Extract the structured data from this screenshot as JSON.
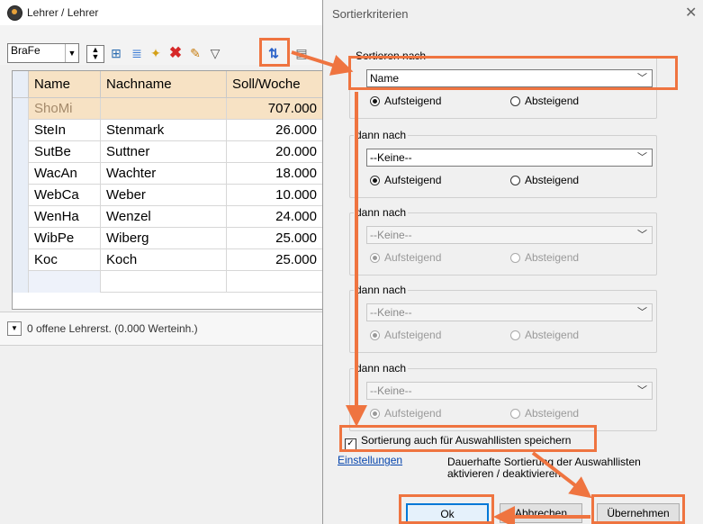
{
  "left_window": {
    "title": "Lehrer / Lehrer",
    "combo_value": "BraFe",
    "grid": {
      "headers": [
        "Name",
        "Nachname",
        "Soll/Woche"
      ],
      "total_row": {
        "name": "ShoMi",
        "nachname": "",
        "soll": "707.000"
      },
      "rows": [
        {
          "name": "SteIn",
          "nachname": "Stenmark",
          "soll": "26.000"
        },
        {
          "name": "SutBe",
          "nachname": "Suttner",
          "soll": "20.000"
        },
        {
          "name": "WacAn",
          "nachname": "Wachter",
          "soll": "18.000"
        },
        {
          "name": "WebCa",
          "nachname": "Weber",
          "soll": "10.000"
        },
        {
          "name": "WenHa",
          "nachname": "Wenzel",
          "soll": "24.000"
        },
        {
          "name": "WibPe",
          "nachname": "Wiberg",
          "soll": "25.000"
        },
        {
          "name": "Koc",
          "nachname": "Koch",
          "soll": "25.000"
        }
      ]
    },
    "status_text": "0 offene Lehrerst. (0.000 Werteinh.)"
  },
  "dialog": {
    "title": "Sortierkriterien",
    "groups": [
      {
        "label": "Sortieren nach",
        "value": "Name",
        "asc": "Aufsteigend",
        "desc": "Absteigend"
      },
      {
        "label": "dann nach",
        "value": "--Keine--",
        "asc": "Aufsteigend",
        "desc": "Absteigend"
      },
      {
        "label": "dann nach",
        "value": "--Keine--",
        "asc": "Aufsteigend",
        "desc": "Absteigend"
      },
      {
        "label": "dann nach",
        "value": "--Keine--",
        "asc": "Aufsteigend",
        "desc": "Absteigend"
      },
      {
        "label": "dann nach",
        "value": "--Keine--",
        "asc": "Aufsteigend",
        "desc": "Absteigend"
      }
    ],
    "checkbox_label": "Sortierung auch für Auswahllisten speichern",
    "link_label": "Einstellungen",
    "hint_line1": "Dauerhafte Sortierung der Auswahllisten",
    "hint_line2": "aktivieren / deaktivieren",
    "buttons": {
      "ok": "Ok",
      "cancel": "Abbrechen",
      "apply": "Übernehmen"
    }
  },
  "colors": {
    "highlight": "#ef7440",
    "header_bg": "#f7e2c4",
    "link": "#0645ad"
  },
  "icons": [
    "app-icon",
    "combo-dropdown-icon",
    "spin-icon",
    "grid-icon",
    "columns-icon",
    "new-icon",
    "delete-icon",
    "edit-icon",
    "filter-icon",
    "sort-icon",
    "close-icon"
  ]
}
